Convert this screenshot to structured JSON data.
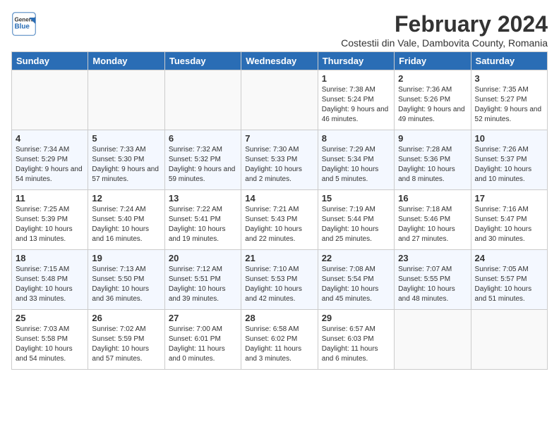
{
  "header": {
    "logo_general": "General",
    "logo_blue": "Blue",
    "month_title": "February 2024",
    "subtitle": "Costestii din Vale, Dambovita County, Romania"
  },
  "days_of_week": [
    "Sunday",
    "Monday",
    "Tuesday",
    "Wednesday",
    "Thursday",
    "Friday",
    "Saturday"
  ],
  "weeks": [
    [
      {
        "day": "",
        "detail": ""
      },
      {
        "day": "",
        "detail": ""
      },
      {
        "day": "",
        "detail": ""
      },
      {
        "day": "",
        "detail": ""
      },
      {
        "day": "1",
        "detail": "Sunrise: 7:38 AM\nSunset: 5:24 PM\nDaylight: 9 hours and 46 minutes."
      },
      {
        "day": "2",
        "detail": "Sunrise: 7:36 AM\nSunset: 5:26 PM\nDaylight: 9 hours and 49 minutes."
      },
      {
        "day": "3",
        "detail": "Sunrise: 7:35 AM\nSunset: 5:27 PM\nDaylight: 9 hours and 52 minutes."
      }
    ],
    [
      {
        "day": "4",
        "detail": "Sunrise: 7:34 AM\nSunset: 5:29 PM\nDaylight: 9 hours and 54 minutes."
      },
      {
        "day": "5",
        "detail": "Sunrise: 7:33 AM\nSunset: 5:30 PM\nDaylight: 9 hours and 57 minutes."
      },
      {
        "day": "6",
        "detail": "Sunrise: 7:32 AM\nSunset: 5:32 PM\nDaylight: 9 hours and 59 minutes."
      },
      {
        "day": "7",
        "detail": "Sunrise: 7:30 AM\nSunset: 5:33 PM\nDaylight: 10 hours and 2 minutes."
      },
      {
        "day": "8",
        "detail": "Sunrise: 7:29 AM\nSunset: 5:34 PM\nDaylight: 10 hours and 5 minutes."
      },
      {
        "day": "9",
        "detail": "Sunrise: 7:28 AM\nSunset: 5:36 PM\nDaylight: 10 hours and 8 minutes."
      },
      {
        "day": "10",
        "detail": "Sunrise: 7:26 AM\nSunset: 5:37 PM\nDaylight: 10 hours and 10 minutes."
      }
    ],
    [
      {
        "day": "11",
        "detail": "Sunrise: 7:25 AM\nSunset: 5:39 PM\nDaylight: 10 hours and 13 minutes."
      },
      {
        "day": "12",
        "detail": "Sunrise: 7:24 AM\nSunset: 5:40 PM\nDaylight: 10 hours and 16 minutes."
      },
      {
        "day": "13",
        "detail": "Sunrise: 7:22 AM\nSunset: 5:41 PM\nDaylight: 10 hours and 19 minutes."
      },
      {
        "day": "14",
        "detail": "Sunrise: 7:21 AM\nSunset: 5:43 PM\nDaylight: 10 hours and 22 minutes."
      },
      {
        "day": "15",
        "detail": "Sunrise: 7:19 AM\nSunset: 5:44 PM\nDaylight: 10 hours and 25 minutes."
      },
      {
        "day": "16",
        "detail": "Sunrise: 7:18 AM\nSunset: 5:46 PM\nDaylight: 10 hours and 27 minutes."
      },
      {
        "day": "17",
        "detail": "Sunrise: 7:16 AM\nSunset: 5:47 PM\nDaylight: 10 hours and 30 minutes."
      }
    ],
    [
      {
        "day": "18",
        "detail": "Sunrise: 7:15 AM\nSunset: 5:48 PM\nDaylight: 10 hours and 33 minutes."
      },
      {
        "day": "19",
        "detail": "Sunrise: 7:13 AM\nSunset: 5:50 PM\nDaylight: 10 hours and 36 minutes."
      },
      {
        "day": "20",
        "detail": "Sunrise: 7:12 AM\nSunset: 5:51 PM\nDaylight: 10 hours and 39 minutes."
      },
      {
        "day": "21",
        "detail": "Sunrise: 7:10 AM\nSunset: 5:53 PM\nDaylight: 10 hours and 42 minutes."
      },
      {
        "day": "22",
        "detail": "Sunrise: 7:08 AM\nSunset: 5:54 PM\nDaylight: 10 hours and 45 minutes."
      },
      {
        "day": "23",
        "detail": "Sunrise: 7:07 AM\nSunset: 5:55 PM\nDaylight: 10 hours and 48 minutes."
      },
      {
        "day": "24",
        "detail": "Sunrise: 7:05 AM\nSunset: 5:57 PM\nDaylight: 10 hours and 51 minutes."
      }
    ],
    [
      {
        "day": "25",
        "detail": "Sunrise: 7:03 AM\nSunset: 5:58 PM\nDaylight: 10 hours and 54 minutes."
      },
      {
        "day": "26",
        "detail": "Sunrise: 7:02 AM\nSunset: 5:59 PM\nDaylight: 10 hours and 57 minutes."
      },
      {
        "day": "27",
        "detail": "Sunrise: 7:00 AM\nSunset: 6:01 PM\nDaylight: 11 hours and 0 minutes."
      },
      {
        "day": "28",
        "detail": "Sunrise: 6:58 AM\nSunset: 6:02 PM\nDaylight: 11 hours and 3 minutes."
      },
      {
        "day": "29",
        "detail": "Sunrise: 6:57 AM\nSunset: 6:03 PM\nDaylight: 11 hours and 6 minutes."
      },
      {
        "day": "",
        "detail": ""
      },
      {
        "day": "",
        "detail": ""
      }
    ]
  ]
}
